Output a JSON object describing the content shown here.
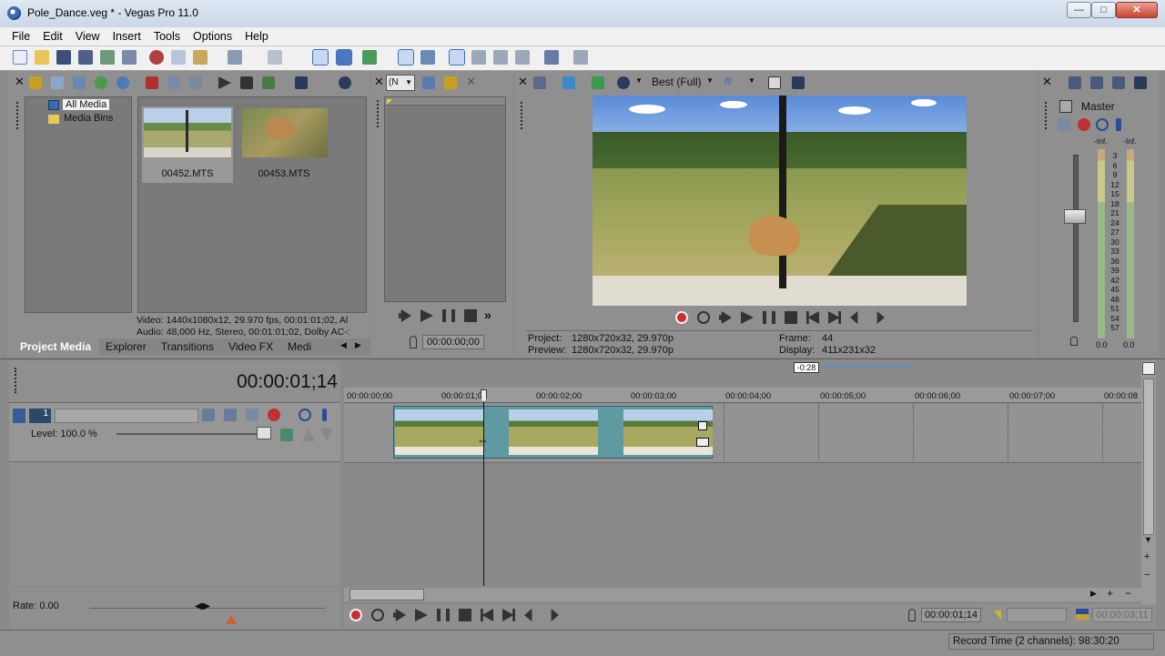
{
  "window": {
    "title": "Pole_Dance.veg * - Vegas Pro 11.0",
    "min_label": "—",
    "max_label": "□",
    "close_label": "✕"
  },
  "menu": [
    "File",
    "Edit",
    "View",
    "Insert",
    "Tools",
    "Options",
    "Help"
  ],
  "project_media": {
    "tree": [
      "All Media",
      "Media Bins"
    ],
    "thumbnails": [
      {
        "name": "00452.MTS",
        "selected": true
      },
      {
        "name": "00453.MTS",
        "selected": false
      }
    ],
    "info_video": "Video: 1440x1080x12, 29.970 fps, 00:01:01;02, Al",
    "info_audio": "Audio: 48,000 Hz, Stereo, 00:01:01;02, Dolby AC-:",
    "tabs": [
      "Project Media",
      "Explorer",
      "Transitions",
      "Video FX",
      "Medi"
    ]
  },
  "trimmer": {
    "dropdown": "(N",
    "timecode": "00:00:00;00"
  },
  "preview": {
    "quality": "Best (Full)",
    "project_label": "Project:",
    "project_value": "1280x720x32, 29.970p",
    "preview_label": "Preview:",
    "preview_value": "1280x720x32, 29.970p",
    "frame_label": "Frame:",
    "frame_value": "44",
    "display_label": "Display:",
    "display_value": "411x231x32"
  },
  "mixer": {
    "title": "Master",
    "peak_left": "-Inf.",
    "peak_right": "-Inf.",
    "scale": [
      "3",
      "6",
      "9",
      "12",
      "15",
      "18",
      "21",
      "24",
      "27",
      "30",
      "33",
      "36",
      "39",
      "42",
      "45",
      "48",
      "51",
      "54",
      "57"
    ],
    "bottom_left": "0.0",
    "bottom_right": "0.0"
  },
  "timeline": {
    "cursor_time": "00:00:01;14",
    "region_label": "-0:28",
    "track_number": "1",
    "level_text": "Level: 100.0 %",
    "ruler": [
      "00:00:00;00",
      "00:00:01;00",
      "00:00:02;00",
      "00:00:03;00",
      "00:00:04;00",
      "00:00:05;00",
      "00:00:06;00",
      "00:00:07;00",
      "00:00:08"
    ],
    "rate_text": "Rate: 0.00",
    "transport_time": "00:00:01;14",
    "end_time": "00:00:03;11",
    "record_time": "Record Time (2 channels): 98:30:20"
  },
  "colors": {
    "panel": "#8f8f8f",
    "accent": "#3b6fb6",
    "clip_teal": "#5f9aa0",
    "record_red": "#d03030"
  }
}
